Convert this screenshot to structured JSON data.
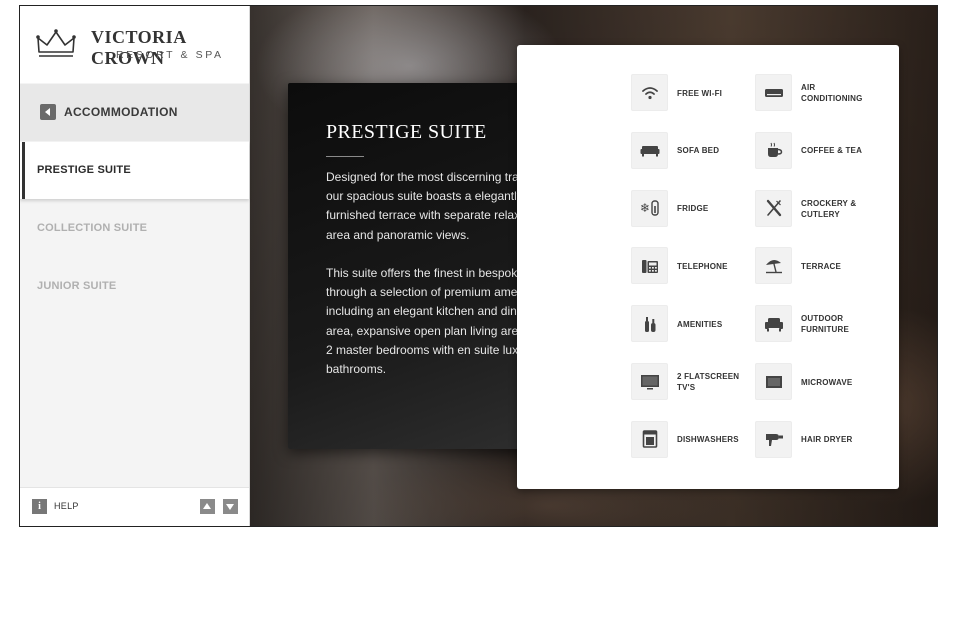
{
  "brand": {
    "name": "VICTORIA CROWN",
    "subtitle": "RESORT & SPA"
  },
  "nav": {
    "back_label": "ACCOMMODATION",
    "items": [
      {
        "label": "PRESTIGE SUITE",
        "active": true
      },
      {
        "label": "COLLECTION SUITE",
        "active": false
      },
      {
        "label": "JUNIOR SUITE",
        "active": false
      }
    ]
  },
  "footer": {
    "help_label": "HELP"
  },
  "suite": {
    "title": "PRESTIGE SUITE",
    "paragraph_1": "Designed for the most discerning travelers, our spacious suite boasts a elegantly furnished terrace with separate relaxation area and panoramic views.",
    "paragraph_2": "This suite offers the finest in bespoke luxury through a selection of premium amenities, including an elegant kitchen and dining area, expansive open plan living areas and 2 master bedrooms with en suite luxurious bathrooms."
  },
  "amenities": [
    {
      "label": "FREE WI-FI",
      "icon": "wifi-icon"
    },
    {
      "label": "AIR CONDITIONING",
      "icon": "air-conditioner-icon"
    },
    {
      "label": "SOFA BED",
      "icon": "sofa-bed-icon"
    },
    {
      "label": "COFFEE & TEA",
      "icon": "coffee-cup-icon"
    },
    {
      "label": "FRIDGE",
      "icon": "fridge-icon"
    },
    {
      "label": "CROCKERY & CUTLERY",
      "icon": "cutlery-icon"
    },
    {
      "label": "TELEPHONE",
      "icon": "telephone-icon"
    },
    {
      "label": "TERRACE",
      "icon": "beach-umbrella-icon"
    },
    {
      "label": "AMENITIES",
      "icon": "toiletries-icon"
    },
    {
      "label": "OUTDOOR FURNITURE",
      "icon": "armchair-icon"
    },
    {
      "label": "2 FLATSCREEN TV'S",
      "icon": "tv-icon"
    },
    {
      "label": "MICROWAVE",
      "icon": "microwave-icon"
    },
    {
      "label": "DISHWASHERS",
      "icon": "dishwasher-icon"
    },
    {
      "label": "HAIR DRYER",
      "icon": "hair-dryer-icon"
    }
  ],
  "colors": {
    "sidebar_bg": "#f4f4f4",
    "card_dark": "#111111",
    "icon_gray": "#444444"
  }
}
